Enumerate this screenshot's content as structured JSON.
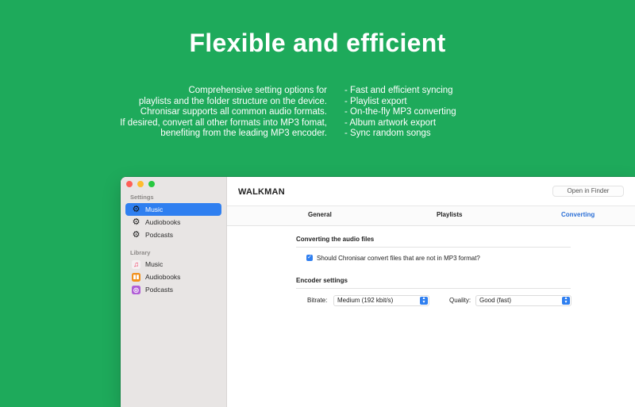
{
  "hero": {
    "title": "Flexible and efficient",
    "description_lines": [
      "Comprehensive setting options for",
      "playlists and the folder structure on the device.",
      "Chronisar supports all common audio formats.",
      "If desired, convert all other formats into MP3 fomat,",
      "benefiting from the leading MP3 encoder."
    ],
    "features": [
      "- Fast and efficient syncing",
      "- Playlist export",
      "- On-the-fly MP3 converting",
      "- Album artwork export",
      "- Sync random songs"
    ]
  },
  "sidebar": {
    "settings_label": "Settings",
    "settings_items": [
      {
        "label": "Music",
        "icon": "gear-icon",
        "active": true
      },
      {
        "label": "Audiobooks",
        "icon": "gear-icon",
        "active": false
      },
      {
        "label": "Podcasts",
        "icon": "gear-icon",
        "active": false
      }
    ],
    "library_label": "Library",
    "library_items": [
      {
        "label": "Music",
        "icon": "music-note-icon",
        "color": "#f5f0f2"
      },
      {
        "label": "Audiobooks",
        "icon": "book-icon",
        "color": "#f2911d"
      },
      {
        "label": "Podcasts",
        "icon": "podcast-icon",
        "color": "#b05dd6"
      }
    ]
  },
  "main": {
    "device_name": "WALKMAN",
    "open_in_finder": "Open in Finder",
    "tabs": [
      {
        "label": "General"
      },
      {
        "label": "Playlists"
      },
      {
        "label": "Converting",
        "active": true
      }
    ],
    "converting": {
      "section_title": "Converting the audio files",
      "convert_checkbox_label": "Should Chronisar convert files that are not in MP3 format?",
      "convert_checked": true
    },
    "encoder": {
      "section_title": "Encoder settings",
      "bitrate_label": "Bitrate:",
      "bitrate_value": "Medium (192 kbit/s)",
      "quality_label": "Quality:",
      "quality_value": "Good (fast)"
    }
  },
  "colors": {
    "background": "#1eaa5b",
    "accent": "#2f7ff0",
    "active_tab": "#2b6fd6"
  }
}
